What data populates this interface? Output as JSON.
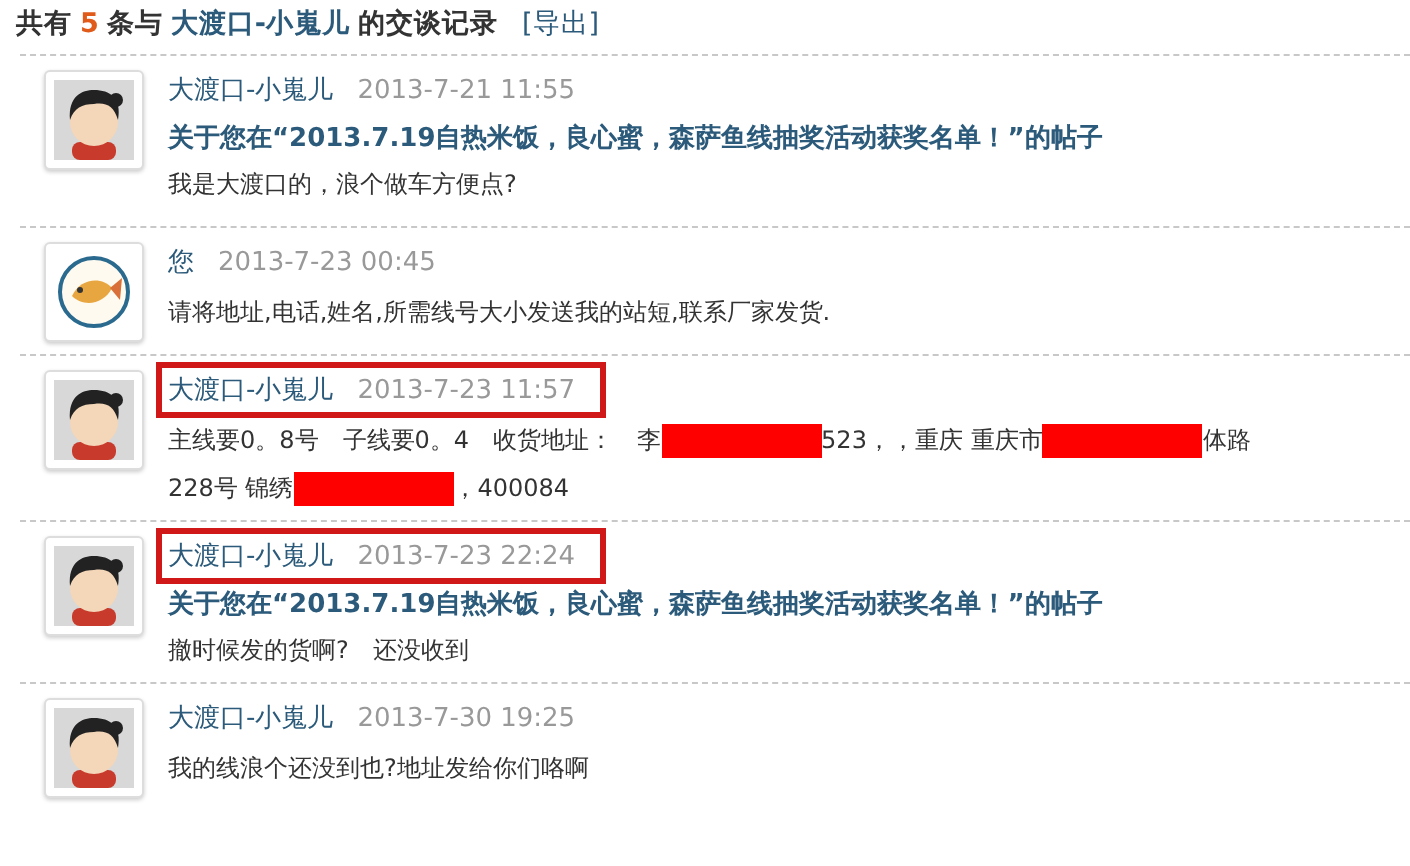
{
  "heading": {
    "prefix": "共有",
    "count": "5",
    "middle": "条与",
    "partner": "大渡口-小嵬儿",
    "suffix": "的交谈记录",
    "export": "[导出]"
  },
  "messages": [
    {
      "avatar": {
        "kind": "person"
      },
      "name": "大渡口-小嵬儿",
      "time": "2013-7-21 11:55",
      "highlighted": false,
      "topic": "关于您在“2013.7.19自热米饭，良心蜜，森萨鱼线抽奖活动获奖名单！”的帖子",
      "lines": [
        [
          {
            "kind": "text",
            "text": "我是大渡口的，浪个做车方便点?"
          }
        ]
      ]
    },
    {
      "avatar": {
        "kind": "emblem"
      },
      "name": "您",
      "time": "2013-7-23 00:45",
      "highlighted": false,
      "lines": [
        [
          {
            "kind": "text",
            "text": "请将地址,电话,姓名,所需线号大小发送我的站短,联系厂家发货."
          }
        ]
      ]
    },
    {
      "avatar": {
        "kind": "person"
      },
      "name": "大渡口-小嵬儿",
      "time": "2013-7-23 11:57",
      "highlighted": true,
      "lines": [
        [
          {
            "kind": "text",
            "text": "主线要0。8号　子线要0。4　收货地址：　李"
          },
          {
            "kind": "redacted"
          },
          {
            "kind": "text",
            "text": "523，，重庆 重庆市"
          },
          {
            "kind": "redacted"
          },
          {
            "kind": "text",
            "text": "体路"
          }
        ],
        [
          {
            "kind": "text",
            "text": "228号 锦绣"
          },
          {
            "kind": "redacted"
          },
          {
            "kind": "text",
            "text": "，400084"
          }
        ]
      ]
    },
    {
      "avatar": {
        "kind": "person"
      },
      "name": "大渡口-小嵬儿",
      "time": "2013-7-23 22:24",
      "highlighted": true,
      "topic": "关于您在“2013.7.19自热米饭，良心蜜，森萨鱼线抽奖活动获奖名单！”的帖子",
      "lines": [
        [
          {
            "kind": "text",
            "text": "撤时候发的货啊?　还没收到"
          }
        ]
      ]
    },
    {
      "avatar": {
        "kind": "person"
      },
      "name": "大渡口-小嵬儿",
      "time": "2013-7-30 19:25",
      "highlighted": false,
      "lines": [
        [
          {
            "kind": "text",
            "text": "我的线浪个还没到也?地址发给你们咯啊"
          }
        ]
      ]
    }
  ]
}
